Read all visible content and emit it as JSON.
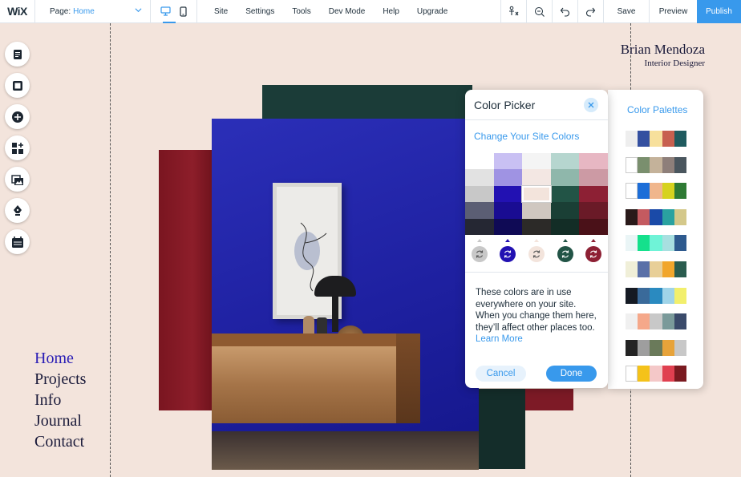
{
  "topbar": {
    "logo": "WiX",
    "page_label": "Page:",
    "page_value": "Home",
    "menu": [
      "Site",
      "Settings",
      "Tools",
      "Dev Mode",
      "Help",
      "Upgrade"
    ],
    "save": "Save",
    "preview": "Preview",
    "publish": "Publish"
  },
  "site": {
    "name": "Brian Mendoza",
    "subtitle": "Interior Designer",
    "nav": [
      "Home",
      "Projects",
      "Info",
      "Journal",
      "Contact"
    ]
  },
  "color_picker": {
    "title": "Color Picker",
    "subtitle": "Change Your Site Colors",
    "grid": [
      [
        "#ffffff",
        "#c9c0f3",
        "#f4f4f4",
        "#b6d6cf",
        "#e7b7c3"
      ],
      [
        "#e2e2e2",
        "#9f93e3",
        "#f3e7e3",
        "#8fb7ab",
        "#cc9aa4"
      ],
      [
        "#c8c8c8",
        "#2211b2",
        "#f3e4dc",
        "#225446",
        "#8d2034"
      ],
      [
        "#5b5e74",
        "#190c92",
        "#cfc7c0",
        "#1a3f35",
        "#6a1a27"
      ],
      [
        "#252733",
        "#0f0a55",
        "#2c2a28",
        "#132d26",
        "#4a1118"
      ]
    ],
    "swatches": [
      "#c8c8c8",
      "#2211b2",
      "#f3e4dc",
      "#225446",
      "#8d2034"
    ],
    "info": "These colors are in use everywhere on your site. When you change them here, they’ll affect other places too.",
    "learn_more": "Learn More",
    "cancel": "Cancel",
    "done": "Done"
  },
  "palettes": {
    "title": "Color Palettes",
    "rows": [
      [
        "#eeeeee",
        "#3450a0",
        "#f7e09c",
        "#c7604f",
        "#1f5b5f"
      ],
      [
        "#ffffff",
        "#7a8f6e",
        "#c4b29a",
        "#8e7f7a",
        "#4a565e"
      ],
      [
        "#ffffff",
        "#1d6ed8",
        "#f0b68c",
        "#d6d21e",
        "#2e7a34"
      ],
      [
        "#2a1a1a",
        "#c45a60",
        "#1a4aa8",
        "#2aa2a0",
        "#d4c88a"
      ],
      [
        "#eaf5f6",
        "#15e08c",
        "#6ff3d7",
        "#a8dfe0",
        "#2e5a8e"
      ],
      [
        "#f0efd8",
        "#5a70a8",
        "#e8cf98",
        "#f1a62c",
        "#2a5c4e"
      ],
      [
        "#151a24",
        "#3a6a9a",
        "#2a8ac0",
        "#a0d4e8",
        "#f2ef6c"
      ],
      [
        "#f0f0f0",
        "#f5a88a",
        "#c8c8c8",
        "#7a9a9a",
        "#3a4a6a"
      ],
      [
        "#232323",
        "#9e9e9e",
        "#6a7a5a",
        "#e7a33a",
        "#c8c8c8"
      ],
      [
        "#ffffff",
        "#f4c21a",
        "#f4c8c8",
        "#e04050",
        "#7a1a20"
      ]
    ]
  }
}
